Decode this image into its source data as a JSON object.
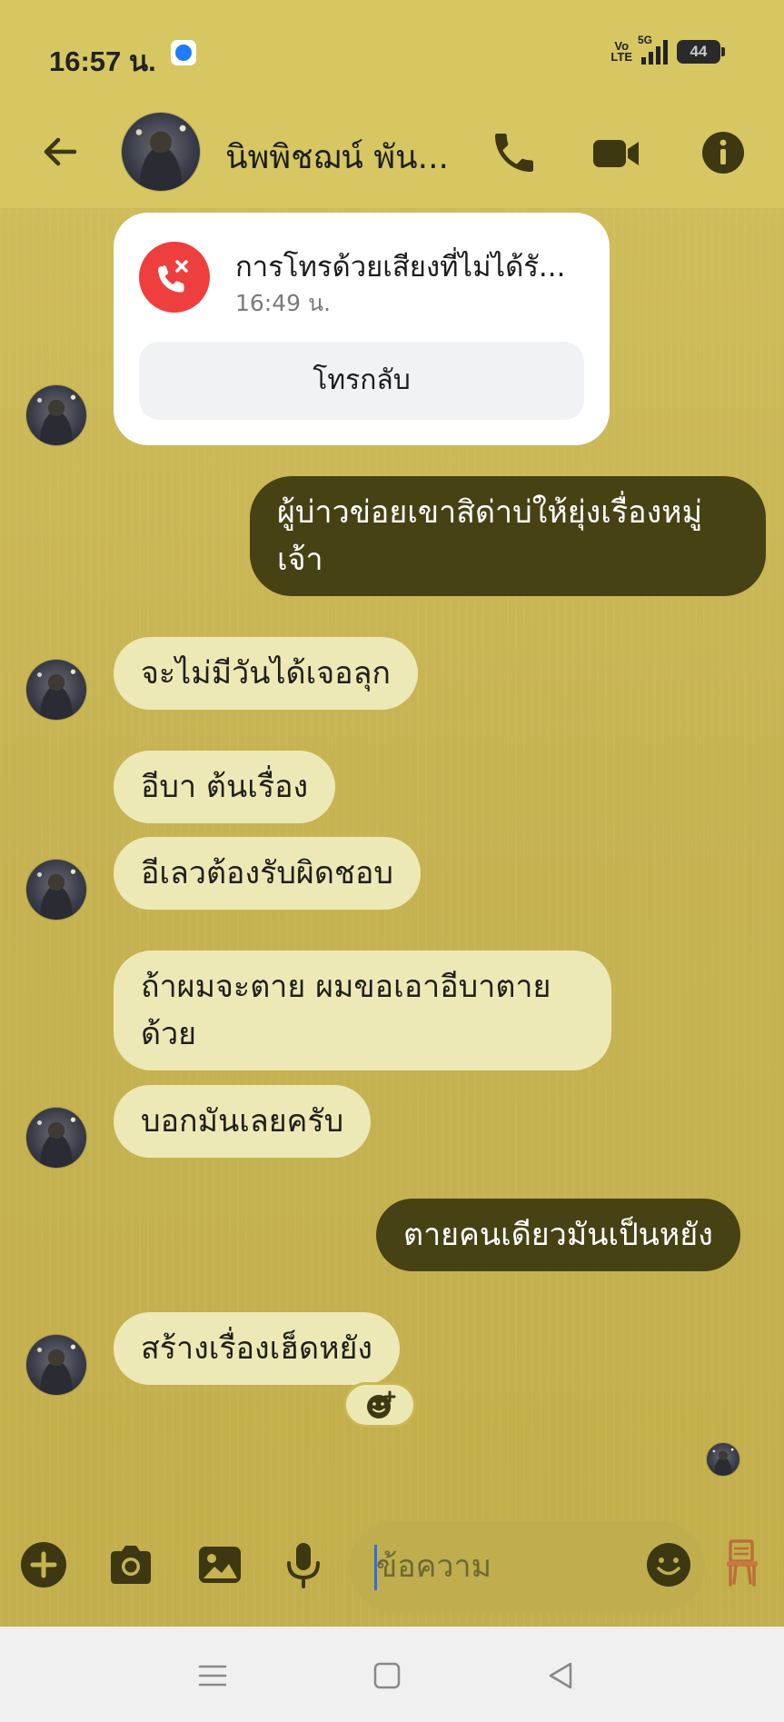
{
  "status_bar": {
    "time": "16:57 น.",
    "network": "VoLTE",
    "network_type": "5G",
    "battery": "44"
  },
  "header": {
    "contact_name": "นิพพิชฌน์ พัน..."
  },
  "call_card": {
    "title": "การโทรด้วยเสียงที่ไม่ได้รั...",
    "time": "16:49 น.",
    "callback_label": "โทรกลับ"
  },
  "messages": [
    {
      "direction": "outgoing",
      "lines": [
        "ผู้บ่าวข่อยเขาสิด่าบ่ให้ยุ่งเรื่องหมู่",
        "เจ้า"
      ]
    },
    {
      "direction": "incoming",
      "lines": [
        "จะไม่มีวันได้เจอลุก"
      ]
    },
    {
      "direction": "incoming",
      "lines": [
        "อีบา ต้นเรื่อง"
      ]
    },
    {
      "direction": "incoming",
      "lines": [
        "อีเลวต้องรับผิดชอบ"
      ]
    },
    {
      "direction": "incoming",
      "lines": [
        "ถ้าผมจะตาย ผมขอเอาอีบาตาย",
        "ด้วย"
      ]
    },
    {
      "direction": "incoming",
      "lines": [
        "บอกมันเลยครับ"
      ]
    },
    {
      "direction": "outgoing",
      "lines": [
        "ตายคนเดียวมันเป็นหยัง"
      ]
    },
    {
      "direction": "incoming",
      "lines": [
        "สร้างเรื่องเฮ็ดหยัง"
      ]
    }
  ],
  "composer": {
    "placeholder": "ข้อความ"
  },
  "colors": {
    "header_bg": "#d6c763",
    "chat_bg": "#c6b352",
    "incoming_bubble": "#ede9b6",
    "outgoing_bubble": "#474214",
    "missed_call_red": "#ef3e3e",
    "icon_dark": "#3d3812"
  },
  "icons": [
    "back-arrow-icon",
    "phone-icon",
    "video-camera-icon",
    "info-icon",
    "missed-call-icon",
    "add-reaction-icon",
    "plus-icon",
    "camera-icon",
    "gallery-icon",
    "microphone-icon",
    "emoji-icon",
    "chair-icon"
  ]
}
